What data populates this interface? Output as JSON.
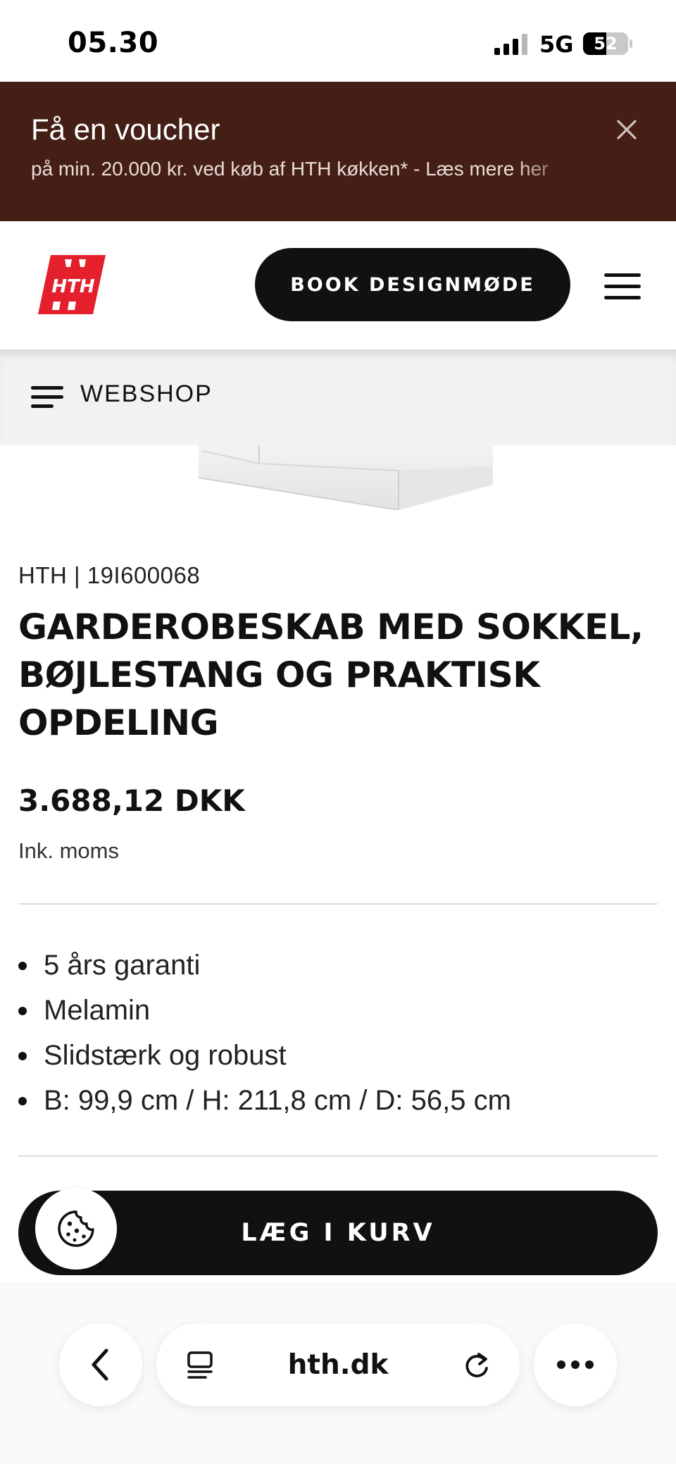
{
  "status_bar": {
    "time": "05.30",
    "network": "5G",
    "battery": "52",
    "battery_level": 0.52
  },
  "voucher": {
    "title": "Få en voucher",
    "text": "på min. 20.000 kr. ved køb af HTH køkken* - Læs mere her"
  },
  "header": {
    "logo_text": "HTH",
    "book_button": "BOOK DESIGNMØDE"
  },
  "webshop": {
    "label": "WEBSHOP"
  },
  "product": {
    "meta": "HTH | 19I600068",
    "title": "GARDEROBESKAB MED SOKKEL, BØJLESTANG OG PRAKTISK OPDELING",
    "price": "3.688,12 DKK",
    "vat_note": "Ink. moms",
    "features": [
      "5 års garanti",
      "Melamin",
      "Slidstærk og robust",
      "B: 99,9 cm / H: 211,8 cm / D: 56,5 cm"
    ]
  },
  "cart": {
    "button_label": "LÆG I KURV"
  },
  "browser": {
    "url": "hth.dk"
  },
  "colors": {
    "banner_bg": "#451f16",
    "brand_red": "#e3202b",
    "button_dark": "#111111",
    "webshop_bg": "#f2f2f2"
  },
  "icons": {
    "close": "close-icon",
    "menu": "hamburger-menu-icon",
    "webshop": "list-icon",
    "cookie": "cookie-icon",
    "back": "chevron-left-icon",
    "reader": "reader-view-icon",
    "reload": "reload-icon",
    "more": "more-dots-icon"
  }
}
